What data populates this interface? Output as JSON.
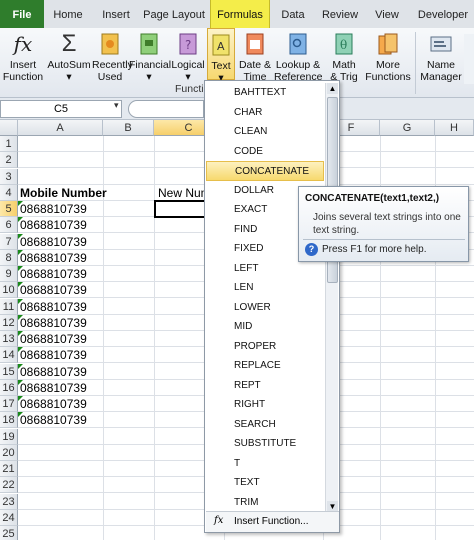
{
  "tabs": {
    "file": "File",
    "home": "Home",
    "insert": "Insert",
    "page_layout": "Page Layout",
    "formulas": "Formulas",
    "data": "Data",
    "review": "Review",
    "view": "View",
    "developer": "Developer"
  },
  "ribbon": {
    "insert_function": [
      "Insert",
      "Function"
    ],
    "autosum": "AutoSum",
    "recently_used": [
      "Recently",
      "Used"
    ],
    "financial": "Financial",
    "logical": "Logical",
    "text": "Text",
    "date_time": [
      "Date &",
      "Time"
    ],
    "lookup": [
      "Lookup &",
      "Reference"
    ],
    "math": [
      "Math",
      "& Trig"
    ],
    "more": [
      "More",
      "Functions"
    ],
    "name_manager": [
      "Name",
      "Manager"
    ],
    "group_caption": "Functio"
  },
  "name_box": "C5",
  "columns": [
    "A",
    "B",
    "C",
    "F",
    "G",
    "H"
  ],
  "rows": [
    "1",
    "2",
    "3",
    "4",
    "5",
    "6",
    "7",
    "8",
    "9",
    "10",
    "11",
    "12",
    "13",
    "14",
    "15",
    "16",
    "17",
    "18",
    "19",
    "20",
    "21",
    "22",
    "23",
    "24",
    "25"
  ],
  "cells": {
    "a4": "Mobile Number",
    "c4": "New Num",
    "mobile_values": [
      "0868810739",
      "0868810739",
      "0868810739",
      "0868810739",
      "0868810739",
      "0868810739",
      "0868810739",
      "0868810739",
      "0868810739",
      "0868810739",
      "0868810739",
      "0868810739",
      "0868810739",
      "0868810739"
    ]
  },
  "dropdown": {
    "items": [
      "BAHTTEXT",
      "CHAR",
      "CLEAN",
      "CODE",
      "CONCATENATE",
      "DOLLAR",
      "EXACT",
      "FIND",
      "FIXED",
      "LEFT",
      "LEN",
      "LOWER",
      "MID",
      "PROPER",
      "REPLACE",
      "REPT",
      "RIGHT",
      "SEARCH",
      "SUBSTITUTE",
      "T",
      "TEXT",
      "TRIM"
    ],
    "highlighted": "CONCATENATE",
    "footer": "Insert Function..."
  },
  "tooltip": {
    "title": "CONCATENATE(text1,text2,)",
    "description": "Joins several text strings into one text string.",
    "help": "Press F1 for more help."
  },
  "colors": {
    "file_tab": "#2f7d2c",
    "formulas_tab": "#f4ed4a",
    "highlight": "#f7d96e",
    "selection": "#000000"
  }
}
